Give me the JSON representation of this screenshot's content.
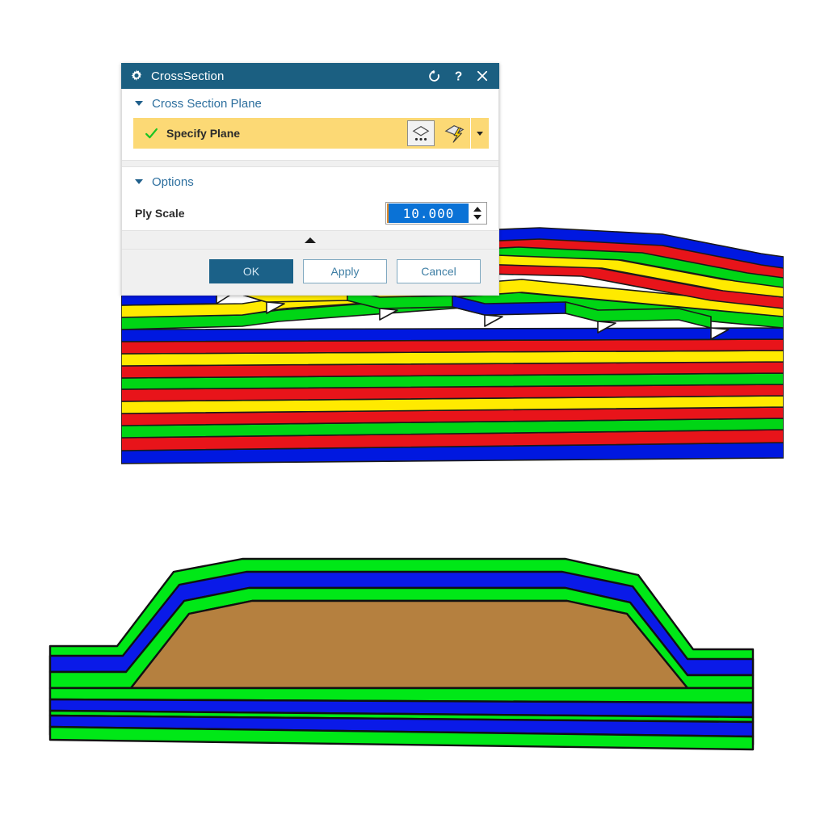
{
  "dialog": {
    "title": "CrossSection",
    "title_icon": "gear-icon",
    "titlebar_buttons": [
      {
        "name": "reset-icon",
        "label": "Reset"
      },
      {
        "name": "help-icon",
        "label": "?"
      },
      {
        "name": "close-icon",
        "label": "Close"
      }
    ],
    "sections": [
      {
        "title": "Cross Section Plane",
        "expanded": true,
        "plane_row": {
          "status_icon": "green-check-icon",
          "label": "Specify Plane",
          "buttons": [
            {
              "name": "plane-points-icon",
              "label": "Specify Plane by points"
            },
            {
              "name": "plane-bolt-icon",
              "label": "Inferred Plane"
            }
          ],
          "dropdown": {
            "name": "chevron-down-icon"
          },
          "highlight_color": "#fcd975"
        }
      },
      {
        "title": "Options",
        "expanded": true,
        "fields": [
          {
            "label": "Ply Scale",
            "value": "10.000",
            "selected": true,
            "control": "spinner"
          }
        ]
      }
    ],
    "collapse_handle": "collapse-up-arrow",
    "buttons": [
      {
        "label": "OK",
        "style": "primary"
      },
      {
        "label": "Apply",
        "style": "secondary"
      },
      {
        "label": "Cancel",
        "style": "secondary"
      }
    ],
    "colors": {
      "titlebar": "#1b5f81",
      "accent": "#2d6f9e",
      "highlight": "#fcd975",
      "selection": "#0a72d6",
      "panel": "#f0f0f0"
    }
  },
  "viewport": {
    "graphics": [
      {
        "name": "upper-ply-stack-cross-section",
        "description": "Composite laminate cross section with tapered ply drop-offs shown at 10x ply scale",
        "ply_colors": [
          "#e8141a",
          "#ffea00",
          "#00d515",
          "#0018e0"
        ],
        "ply_sequence_repeat": [
          "red",
          "yellow",
          "green",
          "blue"
        ],
        "outline_color": "#1a1a1a",
        "resin_pocket_color": "#ffffff",
        "step_count": 7,
        "base_ply_count": 18
      },
      {
        "name": "lower-core-sandwich-cross-section",
        "description": "Sandwich panel cross section with tapered core wrapped by face sheet plies",
        "core_color": "#b5803f",
        "ply_colors": [
          "#00e817",
          "#0a1ae8"
        ],
        "outline_color": "#111111",
        "face_ply_count": 4
      }
    ]
  }
}
